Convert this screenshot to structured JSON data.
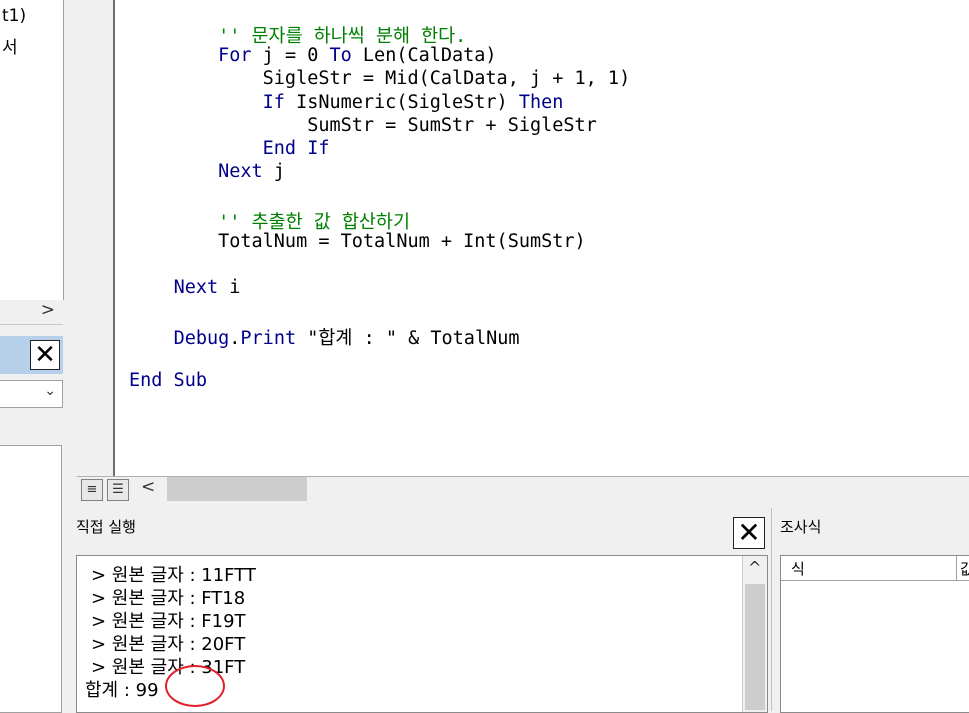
{
  "project_explorer": {
    "tree_lines": [
      "t1)",
      "서"
    ],
    "scroll_right_glyph": ">"
  },
  "properties": {
    "close_glyph": "✕",
    "combo_chevron": "⌄"
  },
  "code_window": {
    "lines": [
      {
        "indent": "        ",
        "parts": [
          {
            "t": "'' 문자를 하나씩 분해 한다.",
            "c": "cm"
          }
        ]
      },
      {
        "indent": "        ",
        "parts": [
          {
            "t": "For",
            "c": "kw"
          },
          {
            "t": " j = 0 "
          },
          {
            "t": "To",
            "c": "kw"
          },
          {
            "t": " Len(CalData)"
          }
        ]
      },
      {
        "indent": "            ",
        "parts": [
          {
            "t": "SigleStr = Mid(CalData, j + 1, 1)"
          }
        ]
      },
      {
        "indent": "            ",
        "parts": [
          {
            "t": "If",
            "c": "kw"
          },
          {
            "t": " IsNumeric(SigleStr) "
          },
          {
            "t": "Then",
            "c": "kw"
          }
        ]
      },
      {
        "indent": "                ",
        "parts": [
          {
            "t": "SumStr = SumStr + SigleStr"
          }
        ]
      },
      {
        "indent": "            ",
        "parts": [
          {
            "t": "End If",
            "c": "kw"
          }
        ]
      },
      {
        "indent": "        ",
        "parts": [
          {
            "t": "Next",
            "c": "kw"
          },
          {
            "t": " j"
          }
        ]
      },
      {
        "indent": "",
        "parts": []
      },
      {
        "indent": "        ",
        "parts": [
          {
            "t": "'' 추출한 값 합산하기",
            "c": "cm"
          }
        ]
      },
      {
        "indent": "        ",
        "parts": [
          {
            "t": "TotalNum = TotalNum + Int(SumStr)"
          }
        ]
      },
      {
        "indent": "",
        "parts": []
      },
      {
        "indent": "    ",
        "parts": [
          {
            "t": "Next",
            "c": "kw"
          },
          {
            "t": " i"
          }
        ]
      },
      {
        "indent": "",
        "parts": []
      },
      {
        "indent": "    ",
        "parts": [
          {
            "t": "Debug",
            "c": "kw"
          },
          {
            "t": "."
          },
          {
            "t": "Print",
            "c": "kw"
          },
          {
            "t": " \"합계 : \" & TotalNum"
          }
        ]
      },
      {
        "indent": "",
        "parts": []
      },
      {
        "indent": "",
        "parts": [
          {
            "t": "End Sub",
            "c": "kw"
          }
        ]
      }
    ],
    "view_buttons": [
      "≡",
      "☰"
    ],
    "hscroll_left_glyph": "<"
  },
  "immediate_window": {
    "title": "직접 실행",
    "close_glyph": "✕",
    "lines": [
      "> 원본 글자 : 11FTT",
      "> 원본 글자 : FT18",
      "> 원본 글자 : F19T",
      "> 원본 글자 : 20FT",
      "> 원본 글자 : 31FT",
      "합계 : 99"
    ],
    "scroll_up_glyph": "^"
  },
  "watch_window": {
    "title": "조사식",
    "column_expression": "식",
    "column_value": "값"
  },
  "colors": {
    "keyword": "#00008b",
    "comment": "#008000",
    "annotation_circle": "#e0202a",
    "panel_header": "#b7d0ea"
  }
}
